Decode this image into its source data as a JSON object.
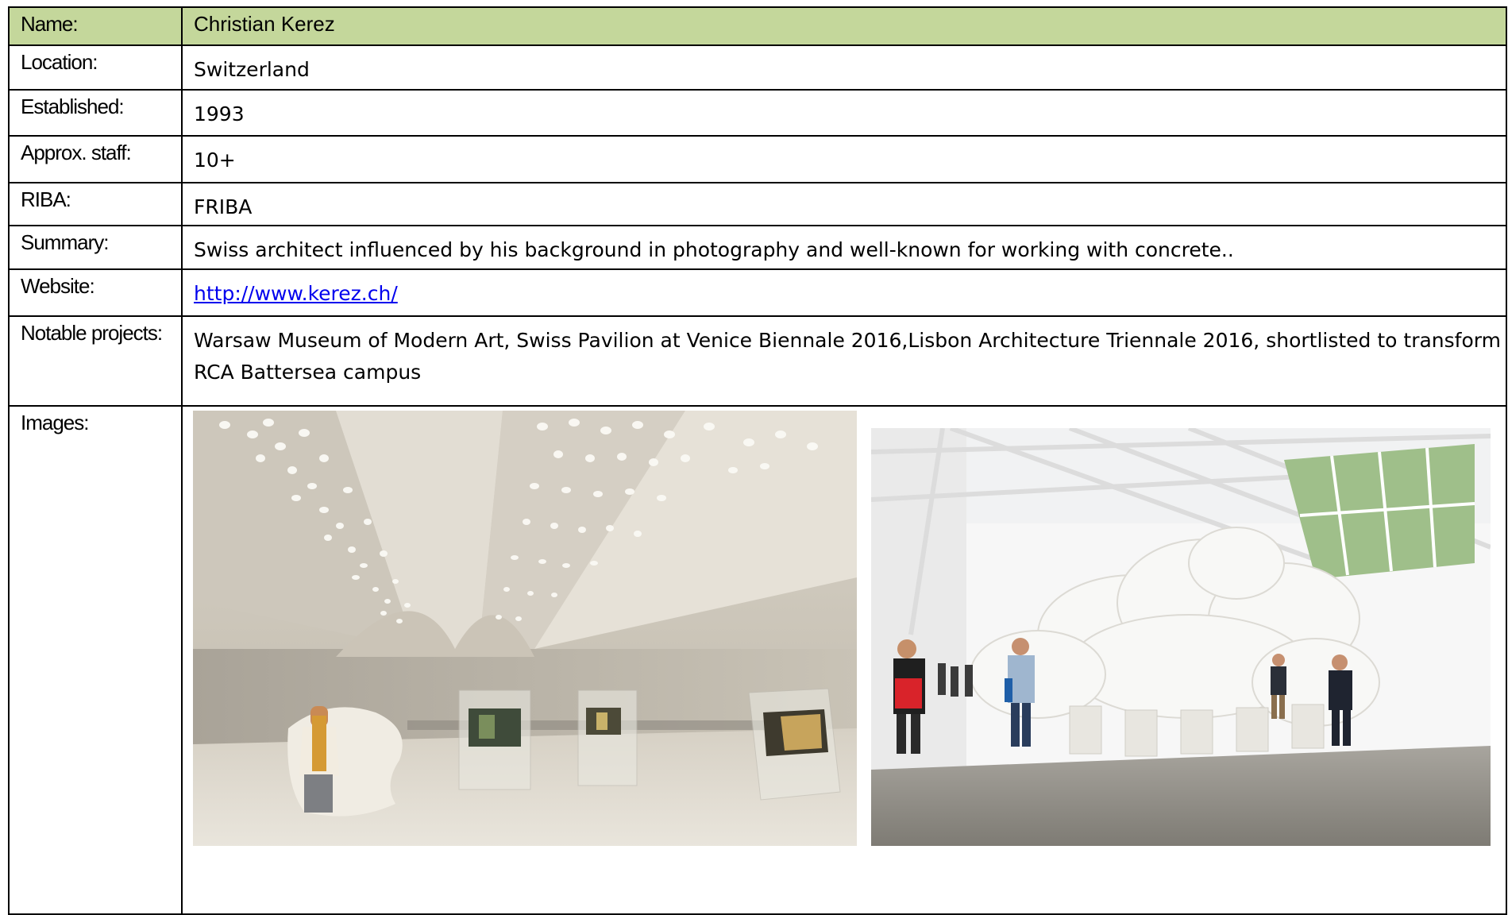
{
  "rows": {
    "name": {
      "label": "Name:",
      "value": "Christian Kerez"
    },
    "location": {
      "label": "Location:",
      "value": "Switzerland"
    },
    "established": {
      "label": "Established:",
      "value": "1993"
    },
    "staff": {
      "label": "Approx. staff:",
      "value": "10+"
    },
    "riba": {
      "label": "RIBA:",
      "value": "FRIBA"
    },
    "summary": {
      "label": "Summary:",
      "value": "Swiss architect influenced by his background in photography and well-known for working with concrete.."
    },
    "website": {
      "label": "Website:",
      "value": "http://www.kerez.ch/"
    },
    "projects": {
      "label": "Notable projects:",
      "value": "Warsaw Museum of Modern Art, Swiss Pavilion at Venice Biennale 2016,Lisbon Architecture Triennale 2016, shortlisted to transform RCA Battersea campus"
    },
    "images": {
      "label": "Images:"
    }
  },
  "colors": {
    "header_bg": "#c4d79b",
    "link": "#0000ee",
    "border": "#000000"
  }
}
